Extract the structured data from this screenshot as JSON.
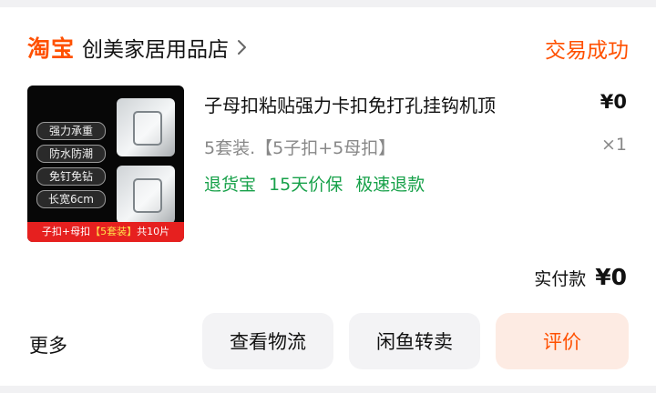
{
  "header": {
    "brand": "淘宝",
    "shop_name": "创美家居用品店",
    "order_status": "交易成功"
  },
  "product": {
    "title": "子母扣粘贴强力卡扣免打孔挂钩机顶",
    "price": "¥0",
    "spec": "5套装.【5子扣+5母扣】",
    "quantity": "×1",
    "services": [
      "退货宝",
      "15天价保",
      "极速退款"
    ],
    "thumbnail": {
      "tags": [
        "强力承重",
        "防水防潮",
        "免钉免钻",
        "长宽6cm"
      ],
      "banner_left": "子扣+母扣",
      "banner_highlight": "【5套装】",
      "banner_right": "共10片"
    }
  },
  "total": {
    "label": "实付款",
    "amount": "¥0"
  },
  "actions": {
    "more": "更多",
    "logistics": "查看物流",
    "resell": "闲鱼转卖",
    "review": "评价"
  },
  "colors": {
    "accent": "#ff5000",
    "service_green": "#18a14a",
    "muted": "#888888"
  }
}
